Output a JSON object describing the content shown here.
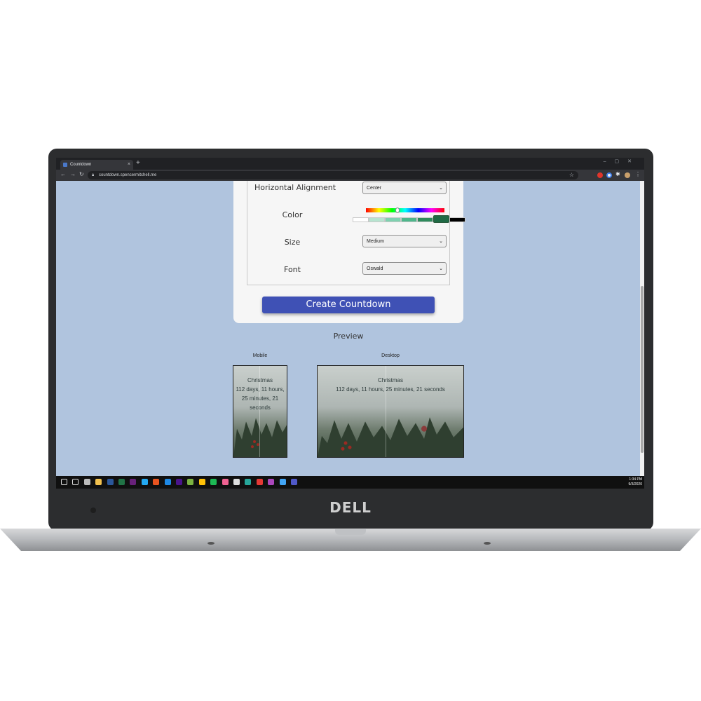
{
  "browser": {
    "tab_title": "Countdown",
    "tab_close": "×",
    "new_tab": "+",
    "url": "countdown.spencermitchell.me",
    "window_controls": "–▢✕"
  },
  "form": {
    "horizontal_alignment": {
      "label": "Horizontal Alignment",
      "value": "Center"
    },
    "color": {
      "label": "Color",
      "hue_level": 0.4,
      "swatches": [
        "#ffffff",
        "#b7e4d0",
        "#7fd1b0",
        "#4fb78c",
        "#2e8a5c",
        "#1f6a45",
        "#000000"
      ],
      "selected_swatch": 5
    },
    "size": {
      "label": "Size",
      "value": "Medium"
    },
    "font": {
      "label": "Font",
      "value": "Oswald"
    },
    "create_button": "Create Countdown"
  },
  "preview": {
    "title": "Preview",
    "mobile": {
      "label": "Mobile",
      "event": "Christmas",
      "countdown_lines": [
        "112 days, 11 hours,",
        "25 minutes, 21",
        "seconds"
      ]
    },
    "desktop": {
      "label": "Desktop",
      "event": "Christmas",
      "countdown": "112 days, 11 hours, 25 minutes, 21 seconds"
    }
  },
  "taskbar": {
    "time": "1:34 PM",
    "date": "9/3/2020",
    "icons": [
      "windows-start-icon",
      "task-view-icon",
      "chrome-icon",
      "file-explorer-icon",
      "word-icon",
      "excel-icon",
      "visual-studio-icon",
      "vscode-icon",
      "ubuntu-icon",
      "app-icon",
      "app-icon",
      "app-icon",
      "app-icon",
      "spotify-icon",
      "app-icon",
      "chrome-icon",
      "app-icon",
      "app-icon",
      "app-icon",
      "app-icon",
      "teams-icon"
    ]
  },
  "laptop": {
    "brand": "DELL"
  },
  "colors": {
    "page_background": "#b0c4de",
    "button": "#3f51b5",
    "card": "#f6f6f6"
  }
}
